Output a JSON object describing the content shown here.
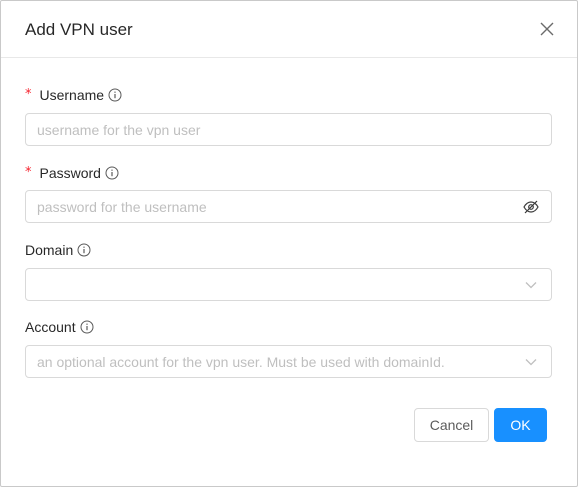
{
  "dialog": {
    "title": "Add VPN user",
    "close_icon": "close-icon"
  },
  "fields": {
    "username": {
      "required_mark": "*",
      "label": "Username",
      "placeholder": "username for the vpn user",
      "value": ""
    },
    "password": {
      "required_mark": "*",
      "label": "Password",
      "placeholder": "password for the username",
      "value": "",
      "suffix_icon": "eye-invisible-icon"
    },
    "domain": {
      "label": "Domain",
      "selected": "",
      "suffix_icon": "chevron-down-icon"
    },
    "account": {
      "label": "Account",
      "placeholder": "an optional account for the vpn user. Must be used with domainId.",
      "selected": "",
      "suffix_icon": "chevron-down-icon"
    }
  },
  "footer": {
    "cancel_label": "Cancel",
    "ok_label": "OK"
  },
  "colors": {
    "primary": "#1890ff",
    "required": "#f5222d",
    "border": "#d9d9d9",
    "placeholder": "#bfbfbf"
  }
}
